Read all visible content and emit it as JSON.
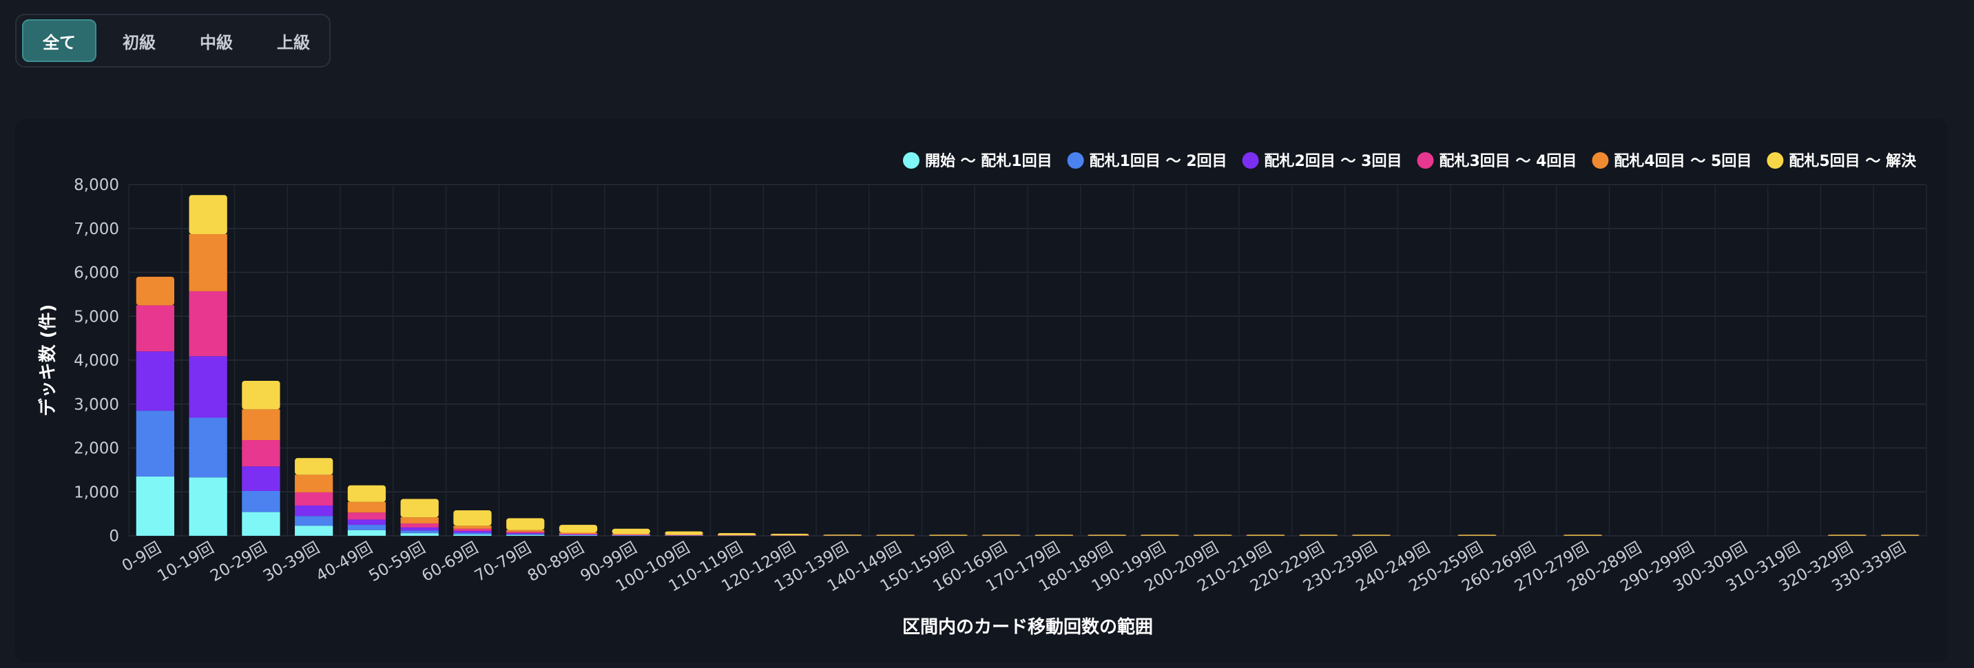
{
  "filter": {
    "tabs": [
      {
        "label": "全て",
        "active": true
      },
      {
        "label": "初級",
        "active": false
      },
      {
        "label": "中級",
        "active": false
      },
      {
        "label": "上級",
        "active": false
      }
    ]
  },
  "chart_data": {
    "type": "bar",
    "stacked": true,
    "xlabel": "区間内のカード移動回数の範囲",
    "ylabel": "デッキ数 (件)",
    "ylim": [
      0,
      8000
    ],
    "yticks": [
      0,
      1000,
      2000,
      3000,
      4000,
      5000,
      6000,
      7000,
      8000
    ],
    "ytick_labels": [
      "0",
      "1,000",
      "2,000",
      "3,000",
      "4,000",
      "5,000",
      "6,000",
      "7,000",
      "8,000"
    ],
    "grid": true,
    "legend_position": "top-right",
    "categories": [
      "0-9回",
      "10-19回",
      "20-29回",
      "30-39回",
      "40-49回",
      "50-59回",
      "60-69回",
      "70-79回",
      "80-89回",
      "90-99回",
      "100-109回",
      "110-119回",
      "120-129回",
      "130-139回",
      "140-149回",
      "150-159回",
      "160-169回",
      "170-179回",
      "180-189回",
      "190-199回",
      "200-209回",
      "210-219回",
      "220-229回",
      "230-239回",
      "240-249回",
      "250-259回",
      "260-269回",
      "270-279回",
      "280-289回",
      "290-299回",
      "300-309回",
      "310-319回",
      "320-329回",
      "330-339回"
    ],
    "series": [
      {
        "name": "開始 〜 配札1回目",
        "color": "#7ff7f7",
        "values": [
          1350,
          1330,
          540,
          230,
          130,
          60,
          30,
          20,
          10,
          5,
          3,
          2,
          1,
          1,
          0,
          0,
          1,
          0,
          0,
          0,
          0,
          0,
          0,
          0,
          0,
          0,
          0,
          0,
          0,
          0,
          0,
          0,
          0,
          0
        ]
      },
      {
        "name": "配札1回目 〜 2回目",
        "color": "#4b82f0",
        "values": [
          1500,
          1360,
          480,
          220,
          120,
          60,
          40,
          20,
          10,
          5,
          3,
          2,
          1,
          1,
          1,
          1,
          1,
          1,
          1,
          1,
          1,
          1,
          1,
          1,
          0,
          1,
          0,
          1,
          0,
          0,
          0,
          0,
          1,
          1
        ]
      },
      {
        "name": "配札2回目 〜 3回目",
        "color": "#7b2ff2",
        "values": [
          1350,
          1400,
          560,
          240,
          120,
          70,
          40,
          20,
          10,
          5,
          4,
          2,
          2,
          1,
          1,
          1,
          1,
          1,
          1,
          1,
          1,
          1,
          1,
          1,
          0,
          1,
          0,
          1,
          0,
          0,
          0,
          0,
          1,
          1
        ]
      },
      {
        "name": "配札3回目 〜 4回目",
        "color": "#e8378f",
        "values": [
          1050,
          1480,
          600,
          300,
          160,
          90,
          50,
          30,
          15,
          10,
          5,
          3,
          2,
          1,
          1,
          1,
          1,
          1,
          1,
          1,
          1,
          1,
          1,
          1,
          0,
          1,
          0,
          1,
          0,
          0,
          0,
          0,
          1,
          1
        ]
      },
      {
        "name": "配札4回目 〜 5回目",
        "color": "#ef8a30",
        "values": [
          650,
          1300,
          700,
          400,
          240,
          140,
          70,
          40,
          25,
          15,
          10,
          6,
          4,
          2,
          1,
          1,
          1,
          1,
          1,
          1,
          1,
          1,
          1,
          1,
          0,
          1,
          0,
          1,
          0,
          0,
          0,
          0,
          1,
          1
        ]
      },
      {
        "name": "配札5回目 〜 解決",
        "color": "#f7d648",
        "values": [
          0,
          890,
          650,
          380,
          380,
          420,
          350,
          270,
          180,
          120,
          75,
          45,
          35,
          20,
          8,
          5,
          5,
          3,
          3,
          5,
          5,
          5,
          5,
          5,
          0,
          5,
          0,
          5,
          0,
          0,
          0,
          0,
          5,
          5
        ]
      }
    ]
  }
}
